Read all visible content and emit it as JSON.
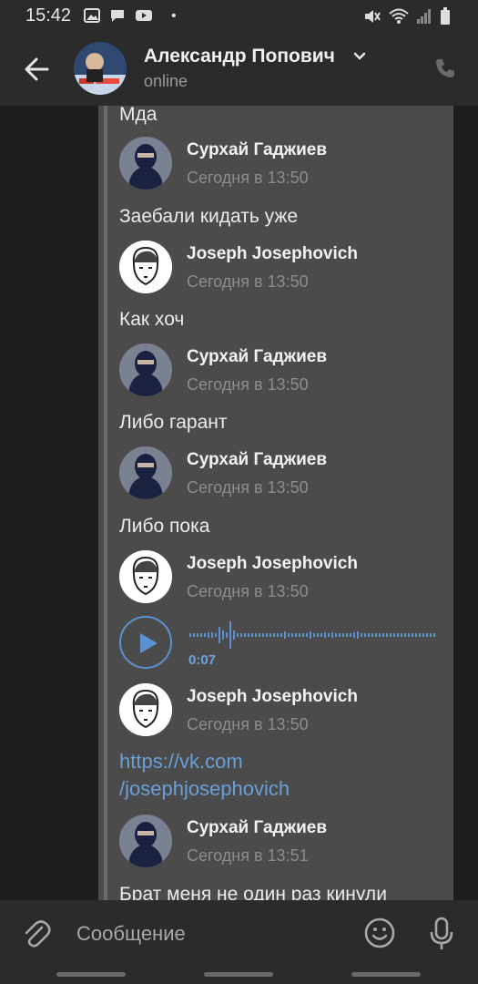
{
  "status_bar": {
    "time": "15:42",
    "dot": "•"
  },
  "header": {
    "name": "Александр Попович",
    "status": "online"
  },
  "chat": {
    "messages": [
      {
        "type": "text",
        "text": "Мда"
      },
      {
        "type": "author",
        "name": "Сурхай Гаджиев",
        "time": "Сегодня в 13:50"
      },
      {
        "type": "text",
        "text": "Заебали кидать уже"
      },
      {
        "type": "author",
        "name": "Joseph Josephovich",
        "time": "Сегодня в 13:50"
      },
      {
        "type": "text",
        "text": "Как хоч"
      },
      {
        "type": "author",
        "name": "Сурхай Гаджиев",
        "time": "Сегодня в 13:50"
      },
      {
        "type": "text",
        "text": "Либо гарант"
      },
      {
        "type": "author",
        "name": "Сурхай Гаджиев",
        "time": "Сегодня в 13:50"
      },
      {
        "type": "text",
        "text": "Либо пока"
      },
      {
        "type": "author",
        "name": "Joseph Josephovich",
        "time": "Сегодня в 13:50"
      },
      {
        "type": "voice",
        "duration": "0:07"
      },
      {
        "type": "author",
        "name": "Joseph Josephovich",
        "time": "Сегодня в 13:50"
      },
      {
        "type": "link",
        "line1": "https://vk.com",
        "line2": "/josephjosephovich"
      },
      {
        "type": "author",
        "name": "Сурхай Гаджиев",
        "time": "Сегодня в 13:51"
      },
      {
        "type": "text",
        "text": "Брат меня не один раз кинули"
      }
    ]
  },
  "input": {
    "placeholder": "Сообщение"
  },
  "colors": {
    "accent": "#5c92d2",
    "link": "#6a9fd8",
    "bubble": "#4b4b4b",
    "bar": "#2b2b2b"
  },
  "icons": [
    "back-arrow-icon",
    "chevron-down-icon",
    "phone-icon",
    "play-icon",
    "paperclip-icon",
    "emoji-icon",
    "microphone-icon"
  ]
}
